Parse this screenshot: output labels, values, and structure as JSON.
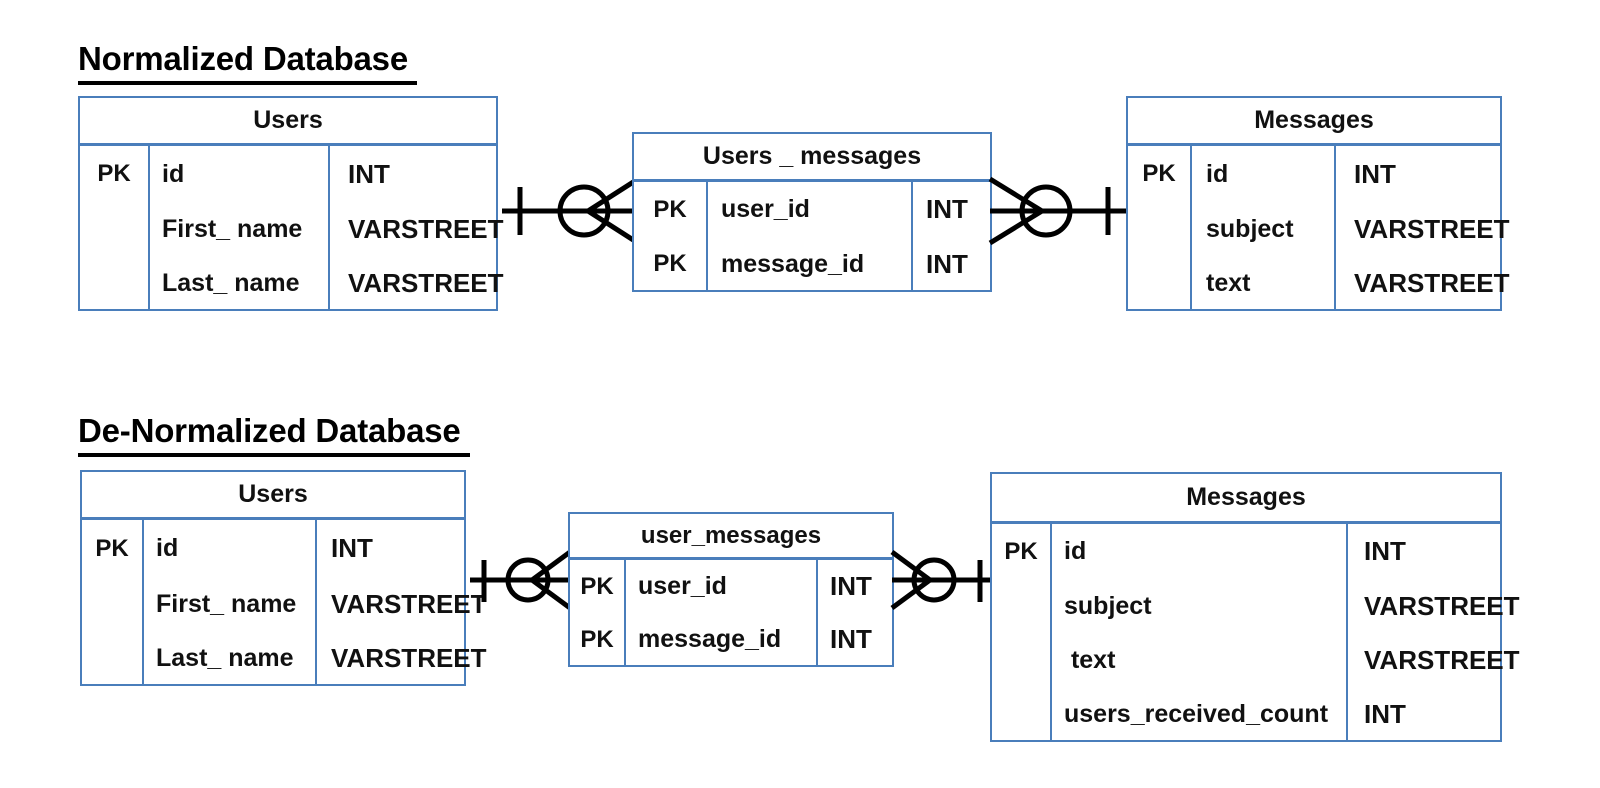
{
  "diagram": {
    "title_normalized": "Normalized Database ",
    "title_denormalized": "De-Normalized Database ",
    "accent_border_color": "#4a7ebb",
    "text_color": "#111111",
    "connector_color": "#000000",
    "background_color": "#ffffff"
  },
  "normalized": {
    "users": {
      "title": "Users",
      "columns": [
        {
          "key": "PK",
          "name": "id",
          "type": "INT"
        },
        {
          "key": "",
          "name": "First_ name",
          "type": "VARSTREET"
        },
        {
          "key": "",
          "name": "Last_ name",
          "type": "VARSTREET"
        }
      ]
    },
    "users_messages": {
      "title": "Users _ messages",
      "columns": [
        {
          "key": "PK",
          "name": "user_id",
          "type": "INT"
        },
        {
          "key": "PK",
          "name": "message_id",
          "type": "INT"
        }
      ]
    },
    "messages": {
      "title": "Messages",
      "columns": [
        {
          "key": "PK",
          "name": "id",
          "type": "INT"
        },
        {
          "key": "",
          "name": "subject",
          "type": "VARSTREET"
        },
        {
          "key": "",
          "name": "text",
          "type": "VARSTREET"
        }
      ]
    },
    "relationships": [
      {
        "from": "Users",
        "to": "Users _ messages",
        "left_cardinality": "one-and-only-one",
        "right_cardinality": "zero-or-many"
      },
      {
        "from": "Users _ messages",
        "to": "Messages",
        "left_cardinality": "zero-or-many",
        "right_cardinality": "one-and-only-one"
      }
    ]
  },
  "denormalized": {
    "users": {
      "title": "Users",
      "columns": [
        {
          "key": "PK",
          "name": "id",
          "type": "INT"
        },
        {
          "key": "",
          "name": "First_ name",
          "type": "VARSTREET"
        },
        {
          "key": "",
          "name": "Last_ name",
          "type": "VARSTREET"
        }
      ]
    },
    "user_messages": {
      "title": "user_messages",
      "columns": [
        {
          "key": "PK",
          "name": "user_id",
          "type": "INT"
        },
        {
          "key": "PK",
          "name": "message_id",
          "type": "INT"
        }
      ]
    },
    "messages": {
      "title": "Messages",
      "columns": [
        {
          "key": "PK",
          "name": "id",
          "type": "INT"
        },
        {
          "key": "",
          "name": "subject",
          "type": "VARSTREET"
        },
        {
          "key": "",
          "name": " text",
          "type": "VARSTREET"
        },
        {
          "key": "",
          "name": "users_received_count",
          "type": "INT"
        }
      ]
    },
    "relationships": [
      {
        "from": "Users",
        "to": "user_messages",
        "left_cardinality": "one-and-only-one",
        "right_cardinality": "zero-or-many"
      },
      {
        "from": "user_messages",
        "to": "Messages",
        "left_cardinality": "zero-or-many",
        "right_cardinality": "one-and-only-one"
      }
    ]
  }
}
